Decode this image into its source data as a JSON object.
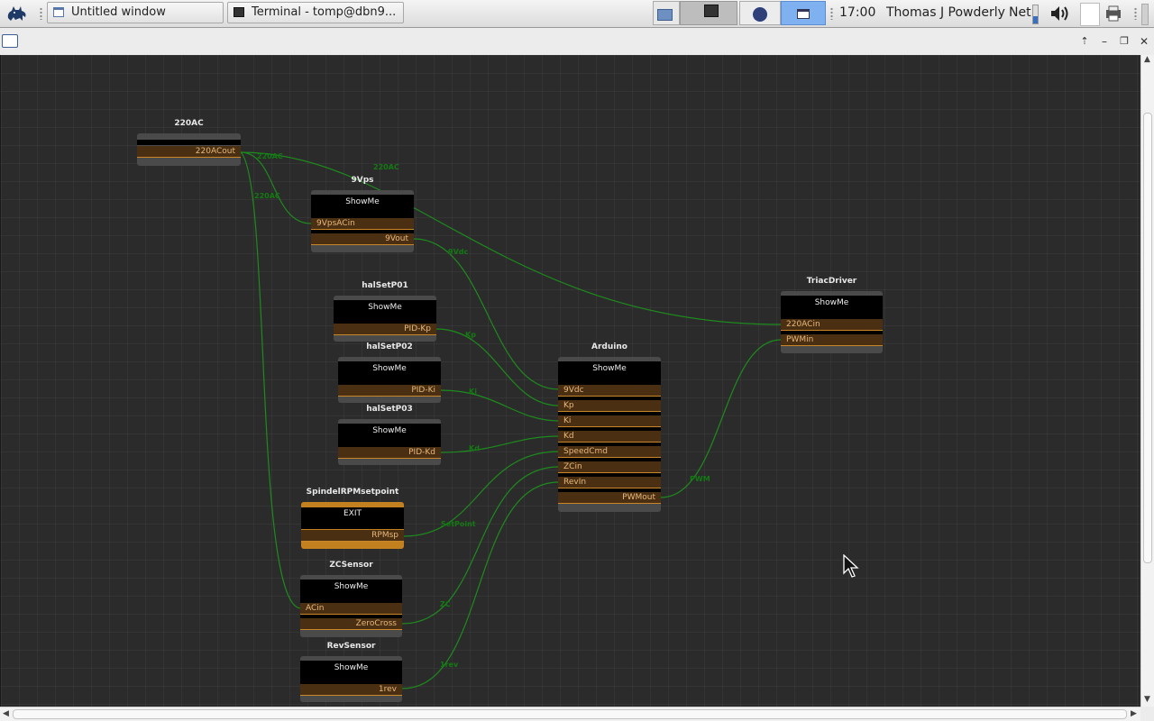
{
  "taskbar": {
    "windows": [
      {
        "label": "Untitled window"
      },
      {
        "label": "Terminal - tomp@dbn9..."
      }
    ],
    "clock": "17:00",
    "user": "Thomas J Powderly",
    "net": "Net"
  },
  "wire_labels": {
    "ac_a": "220AC",
    "ac_b": "220AC",
    "ac_c": "220AC",
    "vdc": "9Vdc",
    "kp": "Kp",
    "ki": "Ki",
    "kd": "Kd",
    "setpoint": "SetPoint",
    "zc": "ZC",
    "rev": "1rev",
    "pwm": "PWM"
  },
  "nodes": {
    "ac220": {
      "title": "220AC",
      "ports": {
        "out": "220ACout"
      }
    },
    "vps9": {
      "title": "9Vps",
      "button": "ShowMe",
      "ports": {
        "in": "9VpsACin",
        "out": "9Vout"
      }
    },
    "halsetp01": {
      "title": "halSetP01",
      "button": "ShowMe",
      "ports": {
        "out": "PID-Kp"
      }
    },
    "halsetp02": {
      "title": "halSetP02",
      "button": "ShowMe",
      "ports": {
        "out": "PID-Ki"
      }
    },
    "halsetp03": {
      "title": "halSetP03",
      "button": "ShowMe",
      "ports": {
        "out": "PID-Kd"
      }
    },
    "spindle": {
      "title": "SpindelRPMsetpoint",
      "button": "EXIT",
      "ports": {
        "out": "RPMsp"
      }
    },
    "zcsensor": {
      "title": "ZCSensor",
      "button": "ShowMe",
      "ports": {
        "in": "ACin",
        "out": "ZeroCross"
      }
    },
    "revsensor": {
      "title": "RevSensor",
      "button": "ShowMe",
      "ports": {
        "out": "1rev"
      }
    },
    "arduino": {
      "title": "Arduino",
      "button": "ShowMe",
      "ports": {
        "in1": "9Vdc",
        "in2": "Kp",
        "in3": "Ki",
        "in4": "Kd",
        "in5": "SpeedCmd",
        "in6": "ZCin",
        "in7": "RevIn",
        "out": "PWMout"
      }
    },
    "triac": {
      "title": "TriacDriver",
      "button": "ShowMe",
      "ports": {
        "in1": "220ACin",
        "in2": "PWMin"
      }
    }
  },
  "icons": {
    "app_menu": "xfce-mouse-icon",
    "window_icon": "window-icon",
    "terminal_icon": "terminal-icon"
  }
}
